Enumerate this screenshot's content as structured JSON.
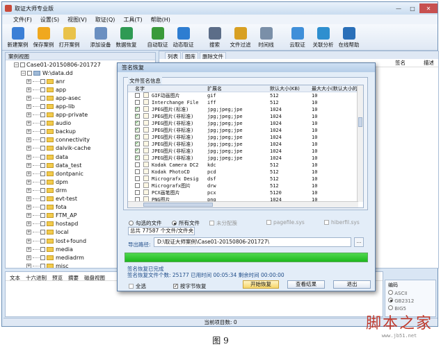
{
  "window": {
    "title": "取证大师专业版",
    "btn_min": "—",
    "btn_max": "□",
    "btn_close": "✕"
  },
  "menu": [
    "文件(F)",
    "设置(S)",
    "视图(V)",
    "取证(Q)",
    "工具(T)",
    "帮助(H)"
  ],
  "toolbar": [
    {
      "label": "新建案例",
      "icon": "new-case-icon",
      "color": "#3b7fd6"
    },
    {
      "label": "保存案例",
      "icon": "save-case-icon",
      "color": "#f0a81e"
    },
    {
      "label": "打开案例",
      "icon": "open-case-icon",
      "color": "#e9c24a"
    },
    {
      "label": "添加设备",
      "icon": "add-device-icon",
      "color": "#6a8fc1"
    },
    {
      "label": "数据恢复",
      "icon": "data-recovery-icon",
      "color": "#2f9a54"
    },
    {
      "label": "自动取证",
      "icon": "auto-forensics-icon",
      "color": "#3a9a3a"
    },
    {
      "label": "动态取证",
      "icon": "dynamic-forensics-icon",
      "color": "#2e7dd1"
    },
    {
      "label": "搜索",
      "icon": "search-icon",
      "color": "#5c6d88"
    },
    {
      "label": "文件过滤",
      "icon": "file-filter-icon",
      "color": "#d8a023"
    },
    {
      "label": "时间线",
      "icon": "timeline-icon",
      "color": "#7a8fa8"
    },
    {
      "label": "云取证",
      "icon": "cloud-forensics-icon",
      "color": "#3f8fd9"
    },
    {
      "label": "关联分析",
      "icon": "link-analysis-icon",
      "color": "#2e8fcf"
    },
    {
      "label": "在线帮助",
      "icon": "online-help-icon",
      "color": "#2a6fb8"
    }
  ],
  "case_view": {
    "header": "案例视图",
    "case_name": "Case01-20150806-201727",
    "image_name": "W:\\data.dd",
    "folders": [
      "anr",
      "app",
      "app-asec",
      "app-lib",
      "app-private",
      "audio",
      "backup",
      "connectivity",
      "dalvik-cache",
      "data",
      "data_test",
      "dontpanic",
      "dpm",
      "drm",
      "evt-test",
      "fota",
      "FTM_AP",
      "hostapd",
      "local",
      "lost+found",
      "media",
      "mediadrm",
      "misc"
    ]
  },
  "right_tabs": [
    "列表",
    "图库",
    "删除文件"
  ],
  "right_columns": [
    "签名",
    "描述"
  ],
  "bottom_tabs": [
    "文本",
    "十六进制",
    "预览",
    "摘要",
    "磁盘视图"
  ],
  "encoding": {
    "title": "编码",
    "options": [
      "ASCII",
      "GB2312",
      "BIG5"
    ]
  },
  "status_bar": "当前项目数: 0",
  "dialog": {
    "title": "签名恢复",
    "group_label": "文件签名信息",
    "columns": [
      "名字",
      "扩展名",
      "默认大小(KB)",
      "最大大小(默认大小的倍数"
    ],
    "rows": [
      {
        "checked": false,
        "name": "GIF动画图片",
        "ext": "gif",
        "def": "512",
        "max": "10"
      },
      {
        "checked": false,
        "name": "Interchange File",
        "ext": "iff",
        "def": "512",
        "max": "10"
      },
      {
        "checked": true,
        "name": "JPEG图片(标准)",
        "ext": "jpg;jpeg;jpe",
        "def": "1024",
        "max": "10"
      },
      {
        "checked": true,
        "name": "JPEG图片(非标准)",
        "ext": "jpg;jpeg;jpe",
        "def": "1024",
        "max": "10"
      },
      {
        "checked": true,
        "name": "JPEG图片(非标准)",
        "ext": "jpg;jpeg;jpe",
        "def": "1024",
        "max": "10"
      },
      {
        "checked": true,
        "name": "JPEG图片(非标准)",
        "ext": "jpg;jpeg;jpe",
        "def": "1024",
        "max": "10"
      },
      {
        "checked": true,
        "name": "JPEG图片(非标准)",
        "ext": "jpg;jpeg;jpe",
        "def": "1024",
        "max": "10"
      },
      {
        "checked": true,
        "name": "JPEG图片(非标准)",
        "ext": "jpg;jpeg;jpe",
        "def": "1024",
        "max": "10"
      },
      {
        "checked": true,
        "name": "JPEG图片(非标准)",
        "ext": "jpg;jpeg;jpe",
        "def": "1024",
        "max": "10"
      },
      {
        "checked": true,
        "name": "JPEG图片(非标准)",
        "ext": "jpg;jpeg;jpe",
        "def": "1024",
        "max": "10"
      },
      {
        "checked": false,
        "name": "Kodak Camera DC2",
        "ext": "kdc",
        "def": "512",
        "max": "10"
      },
      {
        "checked": false,
        "name": "Kodak PhotoCD",
        "ext": "pcd",
        "def": "512",
        "max": "10"
      },
      {
        "checked": false,
        "name": "Micrografx Desig",
        "ext": "dsf",
        "def": "512",
        "max": "10"
      },
      {
        "checked": false,
        "name": "Micrografx图片",
        "ext": "drw",
        "def": "512",
        "max": "10"
      },
      {
        "checked": false,
        "name": "PCX画笔图片",
        "ext": "pcx",
        "def": "5120",
        "max": "10"
      },
      {
        "checked": false,
        "name": "PNG图片",
        "ext": "png",
        "def": "1024",
        "max": "10"
      }
    ],
    "radio_checked": "勾选的文件",
    "radio_all": "所有文件",
    "cb_unallocated": "未分配簇",
    "cb_pagefile": "pagefile.sys",
    "cb_hiberfil": "hiberfil.sys",
    "total_files": "总共 77587 个文件/文件夹",
    "export_label": "导出路径:",
    "export_path": "D:\\取证大师案例\\Case01-20150806-201727\\",
    "browse": "...",
    "progress": 1.0,
    "done_text": "签名恢复已完成",
    "stats": "签名恢复文件个数: 25177    已用时间 00:05:34    剩余时间 00:00:00",
    "select_all": "全选",
    "byte_recovery": "按字节恢复",
    "start_btn": "开始恢复",
    "view_btn": "查看结果",
    "exit_btn": "退出"
  },
  "caption": "图 9",
  "watermark": {
    "title": "脚本之家",
    "url": "www.jb51.net"
  }
}
